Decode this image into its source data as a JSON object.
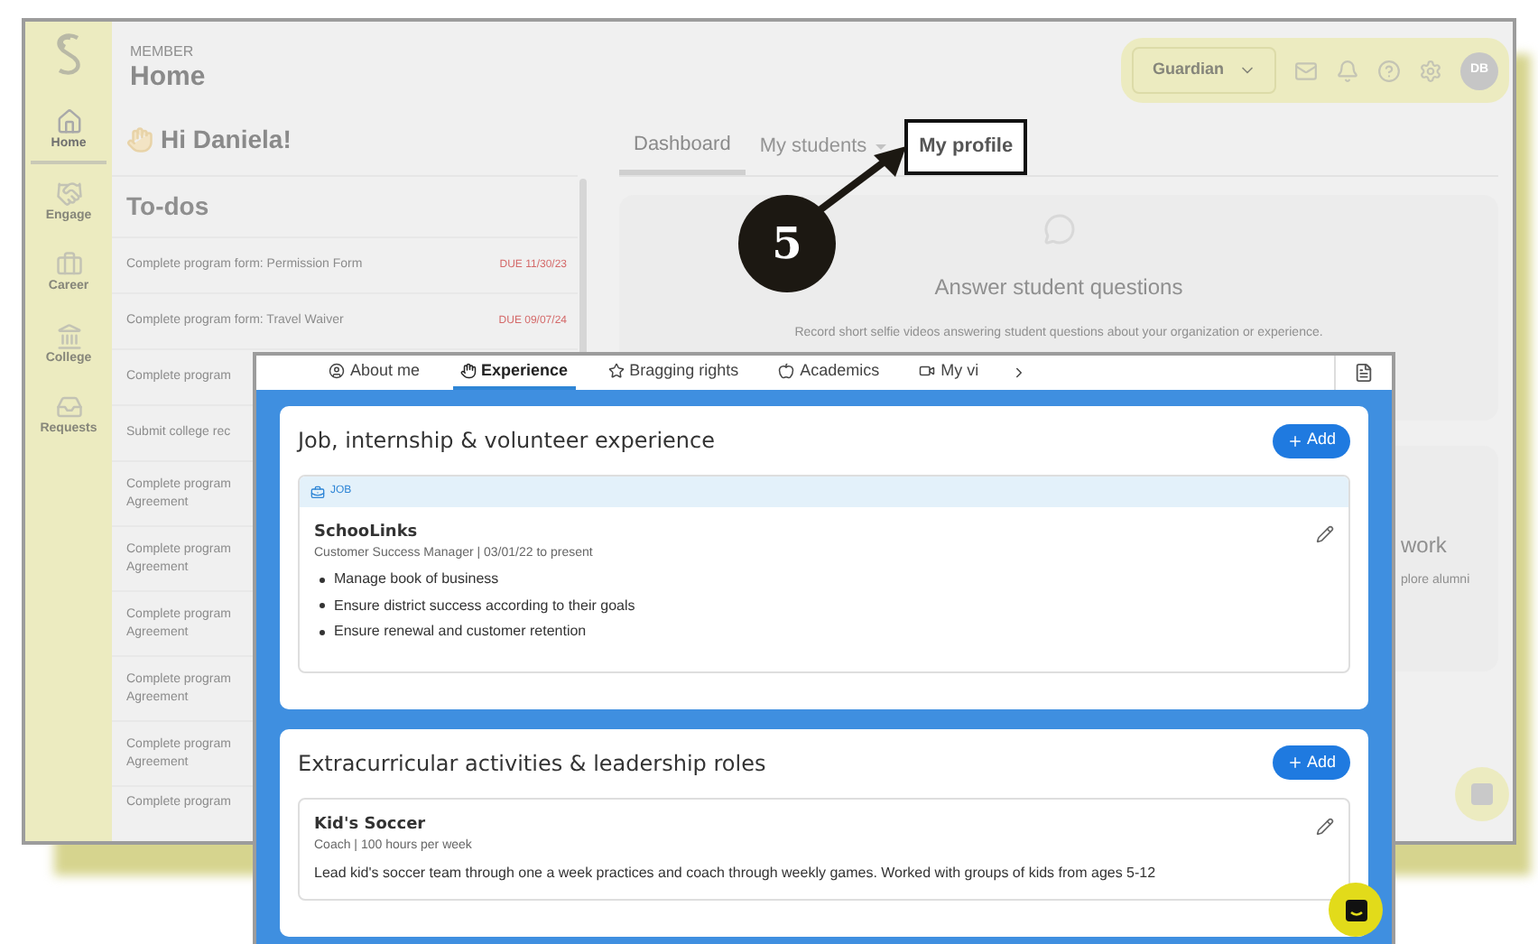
{
  "background_window": {
    "sidebar": {
      "items": [
        {
          "label": "Home",
          "selected": true
        },
        {
          "label": "Engage",
          "selected": false
        },
        {
          "label": "Career",
          "selected": false
        },
        {
          "label": "College",
          "selected": false
        },
        {
          "label": "Requests",
          "selected": false
        }
      ]
    },
    "header": {
      "eyebrow": "MEMBER",
      "title": "Home"
    },
    "top_bar": {
      "role_dropdown": "Guardian",
      "avatar": "DB"
    },
    "greeting": "Hi Daniela!",
    "todos": {
      "title": "To-dos",
      "items": [
        {
          "lines": [
            "Complete program form: Permission Form"
          ],
          "due": "DUE 11/30/23"
        },
        {
          "lines": [
            "Complete program form: Travel Waiver"
          ],
          "due": "DUE 09/07/24"
        },
        {
          "lines": [
            "Complete program"
          ]
        },
        {
          "lines": [
            "Submit college rec"
          ]
        },
        {
          "lines": [
            "Complete program",
            "Agreement"
          ]
        },
        {
          "lines": [
            "Complete program",
            "Agreement"
          ]
        },
        {
          "lines": [
            "Complete program",
            "Agreement"
          ]
        },
        {
          "lines": [
            "Complete program",
            "Agreement"
          ]
        },
        {
          "lines": [
            "Complete program",
            "Agreement"
          ]
        },
        {
          "lines": [
            "Complete program"
          ]
        }
      ]
    },
    "tabs": [
      {
        "label": "Dashboard",
        "selected": true,
        "dropdown": false,
        "highlighted": false
      },
      {
        "label": "My students",
        "selected": false,
        "dropdown": true,
        "highlighted": false
      },
      {
        "label": "My profile",
        "selected": false,
        "dropdown": false,
        "highlighted": true
      }
    ],
    "cards": [
      {
        "title": "Answer student questions",
        "text": "Record short selfie videos answering student questions about your organization or experience."
      },
      {
        "fragments": [
          "work",
          "plore alumni"
        ]
      }
    ]
  },
  "callout": {
    "number": "5"
  },
  "profile_panel": {
    "tabs": [
      {
        "label": "About me",
        "selected": false
      },
      {
        "label": "Experience",
        "selected": true
      },
      {
        "label": "Bragging rights",
        "selected": false
      },
      {
        "label": "Academics",
        "selected": false
      },
      {
        "label": "My vi",
        "selected": false
      }
    ],
    "sections": [
      {
        "title": "Job, internship & volunteer experience",
        "add_label": "Add",
        "entries": [
          {
            "tag": "JOB",
            "name": "SchooLinks",
            "subtitle": "Customer Success Manager | 03/01/22 to present",
            "bullets": [
              "Manage book of business",
              "Ensure district success according to their goals",
              "Ensure renewal and customer retention"
            ]
          }
        ]
      },
      {
        "title": "Extracurricular activities & leadership roles",
        "add_label": "Add",
        "entries": [
          {
            "name": "Kid's Soccer",
            "subtitle": "Coach | 100 hours per week",
            "description": "Lead kid's soccer team through one a week practices and coach through weekly games. Worked with groups of kids from ages 5-12"
          }
        ]
      }
    ]
  }
}
